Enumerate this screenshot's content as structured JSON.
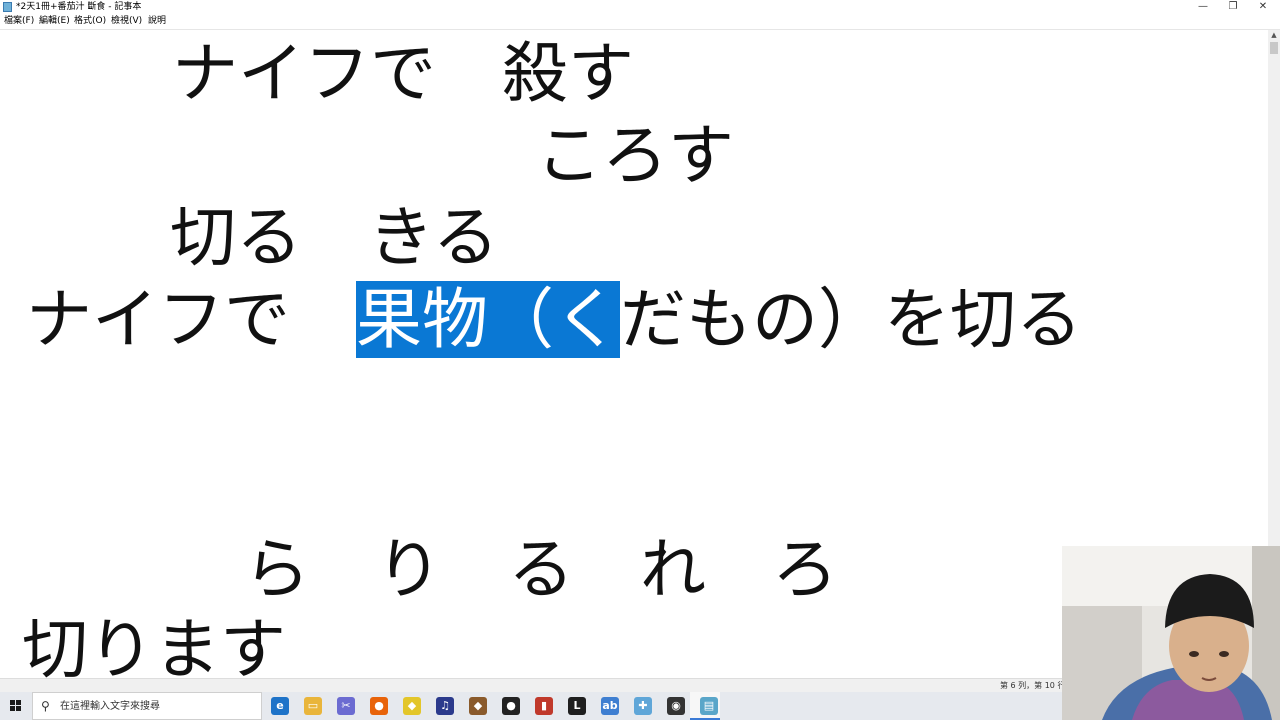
{
  "window": {
    "title": "*2天1冊+番茄汁 斷食 - 記事本",
    "minimize_glyph": "—",
    "restore_glyph": "❐",
    "close_glyph": "✕"
  },
  "menu": [
    "檔案(F)",
    "編輯(E)",
    "格式(O)",
    "檢視(V)",
    "說明"
  ],
  "editor": {
    "line1": "ナイフで　殺す",
    "line2": "ころす",
    "line3": "切る　きる",
    "line4_before": "ナイフで　",
    "line4_selected": "果物（く",
    "line4_after": "だもの）を切る",
    "line5": "ら　り　る　れ　ろ",
    "line6": "切ります"
  },
  "statusbar": {
    "position": "第 6 列，第 10 行"
  },
  "taskbar": {
    "search_placeholder": "在這裡輸入文字來搜尋",
    "search_icon_glyph": "⚲",
    "apps": [
      {
        "name": "edge",
        "glyph": "e",
        "color": "#1e73c8"
      },
      {
        "name": "file-explorer",
        "glyph": "▭",
        "color": "#e9b53b"
      },
      {
        "name": "snip",
        "glyph": "✂",
        "color": "#6b6bd1"
      },
      {
        "name": "firefox",
        "glyph": "●",
        "color": "#e8630a"
      },
      {
        "name": "app-lemon",
        "glyph": "◆",
        "color": "#e3c62a"
      },
      {
        "name": "music",
        "glyph": "♫",
        "color": "#2b3a8c"
      },
      {
        "name": "app-brown",
        "glyph": "◆",
        "color": "#8a5a2b"
      },
      {
        "name": "obs",
        "glyph": "●",
        "color": "#222222"
      },
      {
        "name": "app-book",
        "glyph": "▮",
        "color": "#c0392b"
      },
      {
        "name": "line",
        "glyph": "L",
        "color": "#1f1f1f"
      },
      {
        "name": "app-blue",
        "glyph": "ab",
        "color": "#3f7fd1"
      },
      {
        "name": "app-puzzle",
        "glyph": "✚",
        "color": "#5fa6d8"
      },
      {
        "name": "record",
        "glyph": "◉",
        "color": "#333333"
      },
      {
        "name": "notepad",
        "glyph": "▤",
        "color": "#5aa6c9"
      }
    ]
  }
}
